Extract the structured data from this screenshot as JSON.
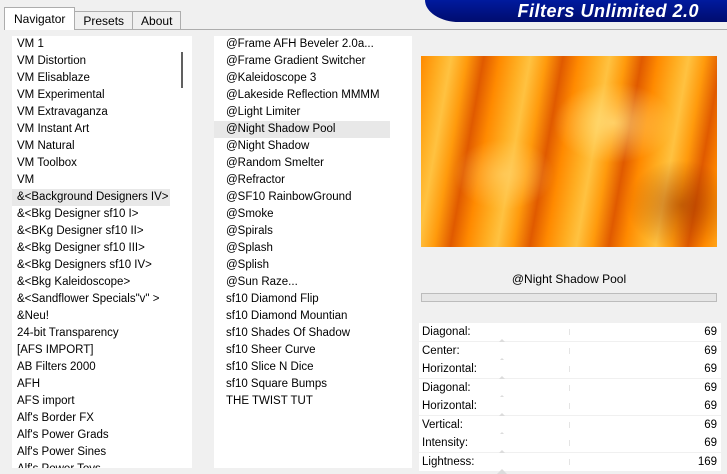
{
  "tabs": [
    "Navigator",
    "Presets",
    "About"
  ],
  "banner": "Filters Unlimited 2.0",
  "categories": [
    "VM 1",
    "VM Distortion",
    "VM Elisablaze",
    "VM Experimental",
    "VM Extravaganza",
    "VM Instant Art",
    "VM Natural",
    "VM Toolbox",
    "VM",
    "&<Background Designers IV>",
    "&<Bkg Designer sf10 I>",
    "&<BKg Designer sf10 II>",
    "&<Bkg Designer sf10 III>",
    "&<Bkg Designers sf10 IV>",
    "&<Bkg Kaleidoscope>",
    "&<Sandflower Specials\"v\" >",
    "&Neu!",
    "24-bit Transparency",
    "[AFS IMPORT]",
    "AB Filters 2000",
    "AFH",
    "AFS import",
    "Alf's Border FX",
    "Alf's Power Grads",
    "Alf's Power Sines",
    "Alf's Power Toys"
  ],
  "selected_category": "&<Background Designers IV>",
  "filters": [
    "@Frame AFH Beveler 2.0a...",
    "@Frame Gradient Switcher",
    "@Kaleidoscope 3",
    "@Lakeside Reflection MMMM",
    "@Light Limiter",
    "@Night Shadow Pool",
    "@Night Shadow",
    "@Random Smelter",
    "@Refractor",
    "@SF10 RainbowGround",
    "@Smoke",
    "@Spirals",
    "@Splash",
    "@Splish",
    "@Sun Raze...",
    "sf10 Diamond Flip",
    "sf10 Diamond Mountian",
    "sf10 Shades Of Shadow",
    "sf10 Sheer Curve",
    "sf10 Slice N Dice",
    "sf10 Square Bumps",
    "THE TWIST TUT"
  ],
  "selected_filter": "@Night Shadow Pool",
  "preview_title": "@Night Shadow Pool",
  "colors": {
    "banner": "#000c6e",
    "preview_base": "#ff8a00"
  },
  "params": [
    {
      "label": "Diagonal:",
      "value": "69"
    },
    {
      "label": "Center:",
      "value": "69"
    },
    {
      "label": "Horizontal:",
      "value": "69"
    },
    {
      "label": "Diagonal:",
      "value": "69"
    },
    {
      "label": "Horizontal:",
      "value": "69"
    },
    {
      "label": "Vertical:",
      "value": "69"
    },
    {
      "label": "Intensity:",
      "value": "69"
    },
    {
      "label": "Lightness:",
      "value": "169"
    }
  ]
}
